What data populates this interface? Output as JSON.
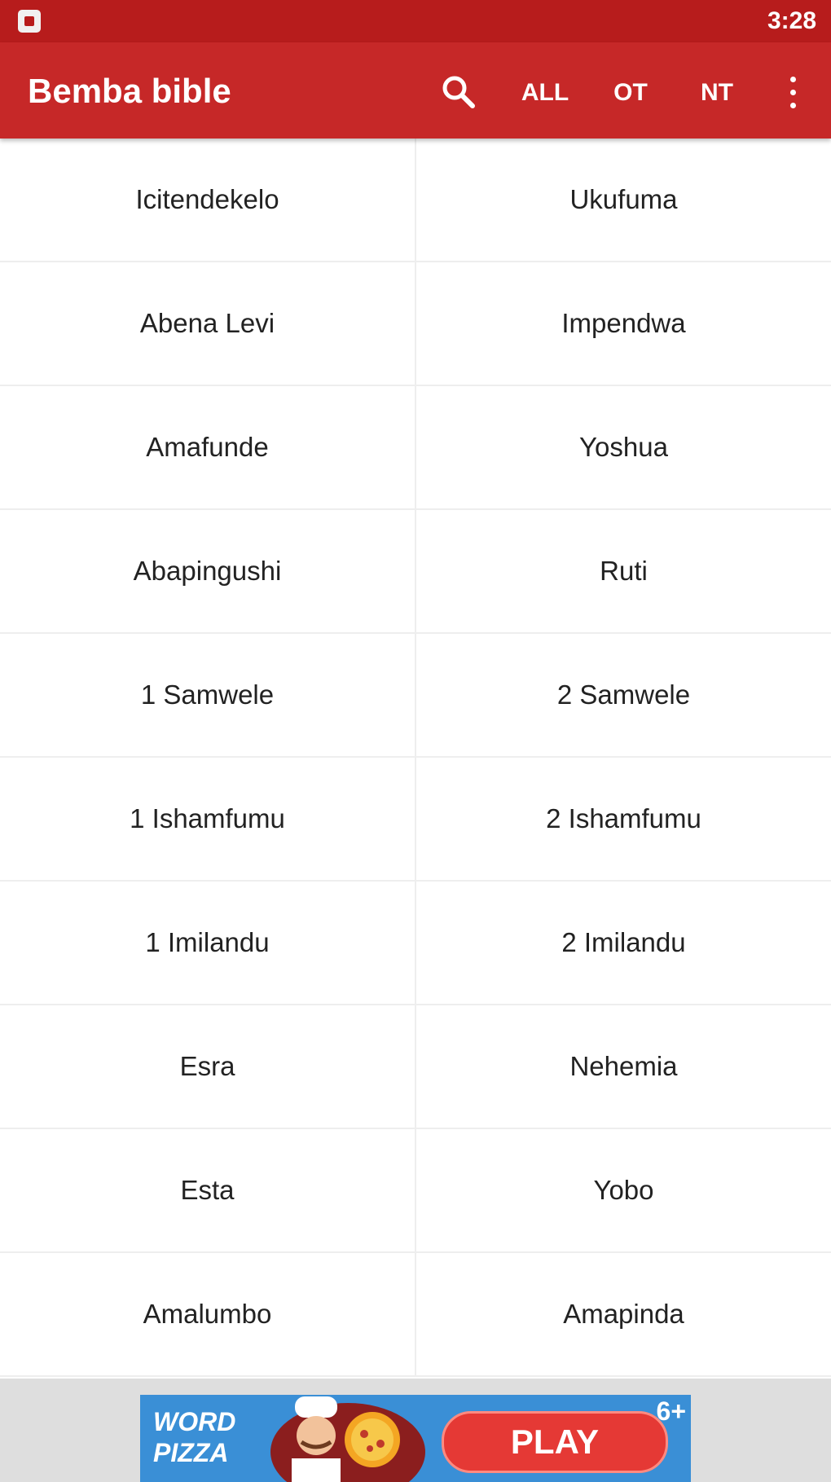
{
  "status_bar": {
    "time": "3:28",
    "notification_icon": "app-notification-icon"
  },
  "app_bar": {
    "title": "Bemba bible",
    "search_icon": "search-icon",
    "filters": [
      "ALL",
      "OT",
      "NT"
    ],
    "overflow_icon": "more-vertical-icon",
    "color": "#c62828",
    "status_color": "#b71c1c"
  },
  "books": [
    [
      "Icitendekelo",
      "Ukufuma"
    ],
    [
      "Abena Levi",
      "Impendwa"
    ],
    [
      "Amafunde",
      "Yoshua"
    ],
    [
      "Abapingushi",
      "Ruti"
    ],
    [
      "1 Samwele",
      "2 Samwele"
    ],
    [
      "1 Ishamfumu",
      "2 Ishamfumu"
    ],
    [
      "1 Imilandu",
      "2 Imilandu"
    ],
    [
      "Esra",
      "Nehemia"
    ],
    [
      "Esta",
      "Yobo"
    ],
    [
      "Amalumbo",
      "Amapinda"
    ]
  ],
  "ad": {
    "title_line1": "WORD",
    "title_line2": "PIZZA",
    "play_label": "PLAY",
    "rating": "6+",
    "image_icon": "chef-with-pizza-icon",
    "banner_color": "#3a8fd6"
  }
}
